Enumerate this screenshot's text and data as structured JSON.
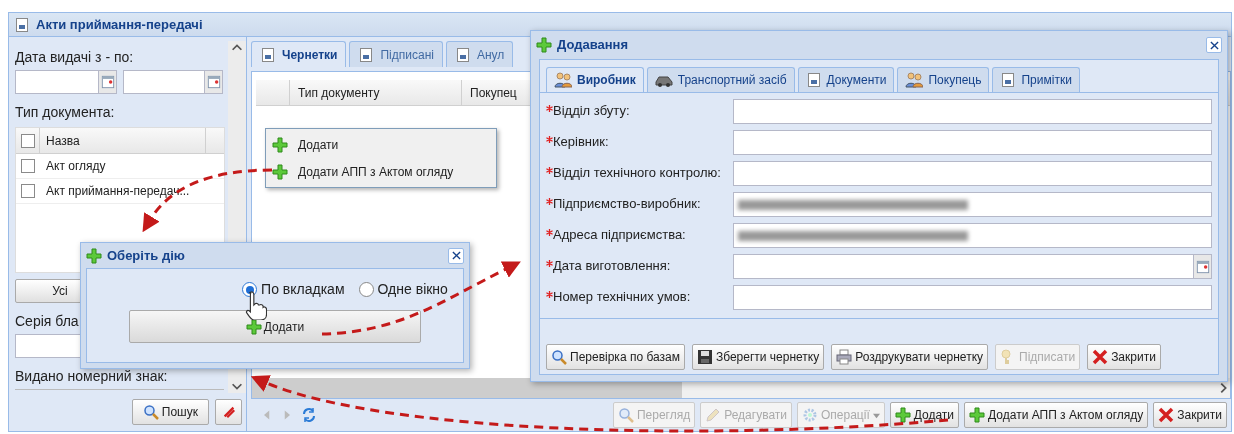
{
  "main_window": {
    "title": "Акти приймання-передачі"
  },
  "filter_panel": {
    "date_label": "Дата видачі з - по:",
    "doc_type_label": "Тип документа:",
    "doc_type_grid": {
      "column": "Назва",
      "header_checked": false,
      "rows": [
        {
          "name": "Акт огляду",
          "checked": false
        },
        {
          "name": "Акт приймання-передач...",
          "checked": false
        }
      ]
    },
    "all_button": "Усі",
    "series_label": "Серія бла",
    "plate_label": "Видано номерний знак:",
    "search_button": "Пошук"
  },
  "tabs": [
    {
      "label": "Чернетки",
      "selected": true
    },
    {
      "label": "Підписані",
      "selected": false
    },
    {
      "label": "Анул",
      "selected": false
    }
  ],
  "grid": {
    "columns": [
      "Тип документу",
      "Покупец"
    ]
  },
  "context_menu": [
    "Додати",
    "Додати АПП з Актом огляду"
  ],
  "toolbar": [
    {
      "label": "Перегляд",
      "kind": "search",
      "disabled": true
    },
    {
      "label": "Редагувати",
      "kind": "pencil",
      "disabled": true
    },
    {
      "label": "Операції",
      "kind": "gear",
      "disabled": true,
      "dropdown": true
    },
    {
      "label": "Додати",
      "kind": "plus",
      "disabled": false
    },
    {
      "label": "Додати АПП з Актом огляду",
      "kind": "plus",
      "disabled": false
    },
    {
      "label": "Закрити",
      "kind": "close",
      "disabled": false
    }
  ],
  "choose_dialog": {
    "title": "Оберіть дію",
    "options": [
      {
        "label": "По вкладкам",
        "selected": true
      },
      {
        "label": "Одне вікно",
        "selected": false
      }
    ],
    "button": "Додати"
  },
  "add_dialog": {
    "title": "Додавання",
    "tabs": [
      {
        "label": "Виробник",
        "kind": "users",
        "selected": true
      },
      {
        "label": "Транспортний засіб",
        "kind": "car",
        "selected": false
      },
      {
        "label": "Документи",
        "kind": "doc",
        "selected": false
      },
      {
        "label": "Покупець",
        "kind": "users",
        "selected": false
      },
      {
        "label": "Примітки",
        "kind": "doc",
        "selected": false
      }
    ],
    "fields": [
      {
        "label": "Відділ збуту:",
        "required": true,
        "kind": "text"
      },
      {
        "label": "Керівник:",
        "required": true,
        "kind": "text"
      },
      {
        "label": "Відділ технічного контролю:",
        "required": true,
        "kind": "text"
      },
      {
        "label": "Підприємство-виробник:",
        "required": true,
        "kind": "blurred"
      },
      {
        "label": "Адреса підприємства:",
        "required": true,
        "kind": "blurred"
      },
      {
        "label": "Дата виготовлення:",
        "required": true,
        "kind": "date"
      },
      {
        "label": "Номер технічних умов:",
        "required": true,
        "kind": "text"
      }
    ],
    "buttons": [
      {
        "label": "Перевірка по базам",
        "kind": "search",
        "disabled": false
      },
      {
        "label": "Зберегти чернетку",
        "kind": "floppy",
        "disabled": false
      },
      {
        "label": "Роздрукувати чернетку",
        "kind": "printer",
        "disabled": false
      },
      {
        "label": "Підписати",
        "kind": "key",
        "disabled": true
      },
      {
        "label": "Закрити",
        "kind": "close",
        "disabled": false
      }
    ]
  }
}
